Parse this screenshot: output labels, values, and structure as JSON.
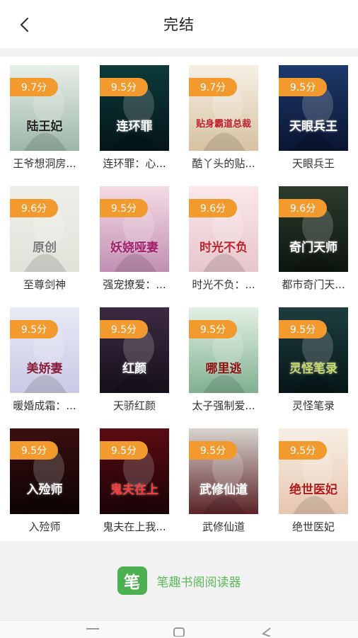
{
  "header": {
    "title": "完结"
  },
  "books": [
    {
      "title": "王爷想洞房...",
      "rating": "9.7分",
      "cover_text": "陆王妃",
      "bg1": "#e9efe9",
      "bg2": "#9bb6a8",
      "ink": "#222222"
    },
    {
      "title": "连环罪：心...",
      "rating": "9.5分",
      "cover_text": "连环罪",
      "bg1": "#0d3b3a",
      "bg2": "#04141a",
      "ink": "#ffffff"
    },
    {
      "title": "酷丫头的贴...",
      "rating": "9.7分",
      "cover_text": "贴身霸道总裁",
      "bg1": "#f6f0e6",
      "bg2": "#d7c2a0",
      "ink": "#c0212c"
    },
    {
      "title": "天眼兵王",
      "rating": "9.5分",
      "cover_text": "天眼兵王",
      "bg1": "#1d3a6c",
      "bg2": "#0a1430",
      "ink": "#ffffff"
    },
    {
      "title": "至尊剑神",
      "rating": "9.6分",
      "cover_text": "原创",
      "bg1": "#efefe9",
      "bg2": "#e2e2da",
      "ink": "#7a7a7a"
    },
    {
      "title": "强宠撩爱：...",
      "rating": "9.5分",
      "cover_text": "妖娆哑妻",
      "bg1": "#f4dbe4",
      "bg2": "#c28fb2",
      "ink": "#a0206a"
    },
    {
      "title": "时光不负：...",
      "rating": "9.6分",
      "cover_text": "时光不负",
      "bg1": "#fbe7ea",
      "bg2": "#e6c6cc",
      "ink": "#c0212c"
    },
    {
      "title": "都市奇门天...",
      "rating": "9.6分",
      "cover_text": "奇门天师",
      "bg1": "#2b3b2c",
      "bg2": "#0d160f",
      "ink": "#ffffff"
    },
    {
      "title": "暖婚成霜：...",
      "rating": "9.5分",
      "cover_text": "美娇妻",
      "bg1": "#e8eaf5",
      "bg2": "#c9c8e6",
      "ink": "#8a1d3b"
    },
    {
      "title": "天骄红颜",
      "rating": "9.5分",
      "cover_text": "红颜",
      "bg1": "#3d2a44",
      "bg2": "#15101a",
      "ink": "#ffffff"
    },
    {
      "title": "太子强制爱...",
      "rating": "9.5分",
      "cover_text": "哪里逃",
      "bg1": "#e3f1e4",
      "bg2": "#7fb090",
      "ink": "#8a1010"
    },
    {
      "title": "灵怪笔录",
      "rating": "9.5分",
      "cover_text": "灵怪笔录",
      "bg1": "#1d3d3f",
      "bg2": "#071617",
      "ink": "#c9d86a"
    },
    {
      "title": "入殓师",
      "rating": "9.5分",
      "cover_text": "入殓师",
      "bg1": "#3a0f0f",
      "bg2": "#0c0303",
      "ink": "#ffffff"
    },
    {
      "title": "鬼夫在上我...",
      "rating": "9.5分",
      "cover_text": "鬼夫在上",
      "bg1": "#5a0b12",
      "bg2": "#1a0306",
      "ink": "#ff3b3b"
    },
    {
      "title": "武修仙道",
      "rating": "9.5分",
      "cover_text": "武修仙道",
      "bg1": "#d9d4cf",
      "bg2": "#5b2226",
      "ink": "#ffffff"
    },
    {
      "title": "绝世医妃",
      "rating": "9.5分",
      "cover_text": "绝世医妃",
      "bg1": "#f7efe4",
      "bg2": "#e6c6b0",
      "ink": "#b31a1a"
    }
  ],
  "footer": {
    "logo_char": "笔",
    "app_name": "笔趣书阁阅读器"
  },
  "colors": {
    "badge": "#f29a2e",
    "accent": "#5cb85c"
  }
}
